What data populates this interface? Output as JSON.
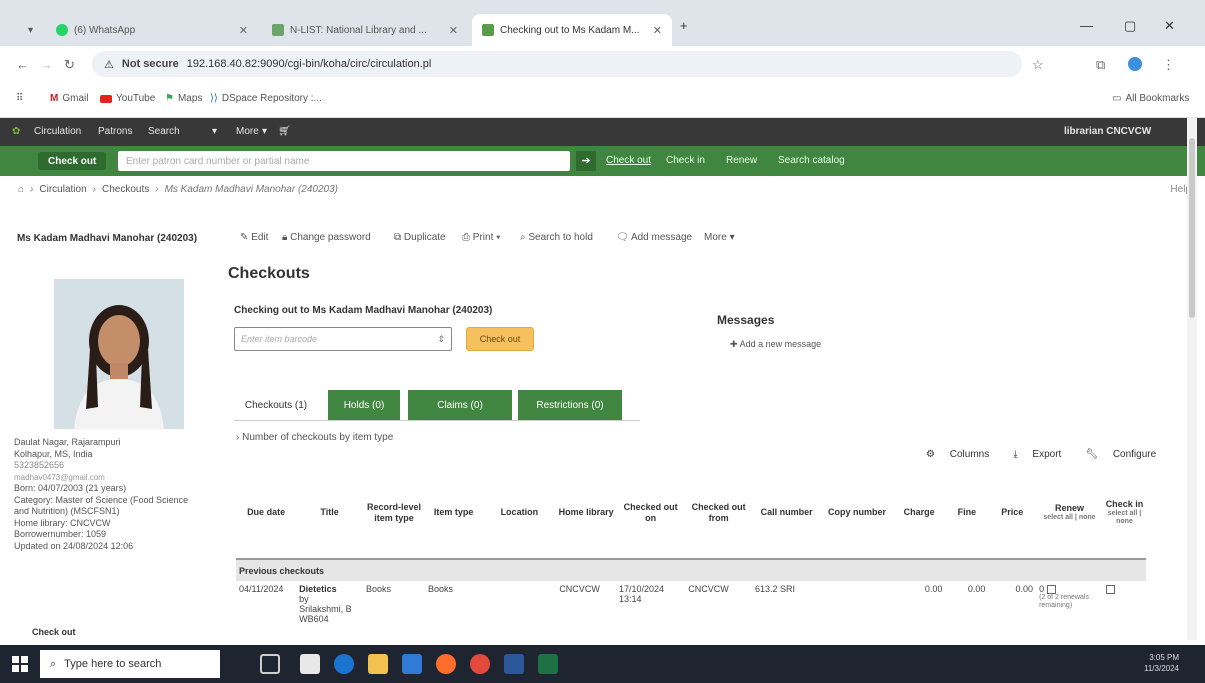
{
  "browser": {
    "tabs": [
      {
        "label": "(6) WhatsApp"
      },
      {
        "label": "N-LIST: National Library and ..."
      },
      {
        "label": "Checking out to Ms Kadam M..."
      }
    ],
    "not_secure": "Not secure",
    "url": "192.168.40.82:9090/cgi-bin/koha/circ/circulation.pl",
    "bookmarks": [
      "Gmail",
      "YouTube",
      "Maps",
      "DSpace Repository :..."
    ],
    "all_bookmarks": "All Bookmarks"
  },
  "koha_nav": {
    "items": [
      "Circulation",
      "Patrons",
      "Search",
      "More",
      "▾"
    ],
    "user": "librarian CNCVCW"
  },
  "checkout_bar": {
    "label": "Check out",
    "placeholder": "Enter patron card number or partial name",
    "links": [
      "Check out",
      "Check in",
      "Renew",
      "Search catalog"
    ]
  },
  "breadcrumb": {
    "items": [
      "Circulation",
      "Checkouts",
      "Ms Kadam Madhavi Manohar (240203)"
    ],
    "help": "Help"
  },
  "patron": {
    "name": "Ms Kadam Madhavi Manohar (240203)",
    "address": "Daulat Nagar, Rajarampuri",
    "city": "Kolhapur, MS, India",
    "phone": "5323852656",
    "email": "madhav0473@gmail.com",
    "born": "Born: 04/07/2003 (21 years)",
    "category": "Category: Master of Science (Food Science and Nutrition) (MSCFSN1)",
    "home_library": "Home library: CNCVCW",
    "borrowernumber": "Borrowernumber: 1059",
    "updated": "Updated on 24/08/2024 12:06",
    "check_out": "Check out"
  },
  "toolbar": {
    "edit": "Edit",
    "change_password": "Change password",
    "duplicate": "Duplicate",
    "print": "Print",
    "search_to_hold": "Search to hold",
    "add_message": "Add message",
    "more": "More"
  },
  "main": {
    "title": "Checkouts",
    "checking_out_to": "Checking out to Ms Kadam Madhavi Manohar (240203)",
    "barcode_placeholder": "Enter item barcode",
    "checkout_button": "Check out",
    "messages_title": "Messages",
    "add_new_message": "Add a new message"
  },
  "tabs": [
    {
      "label": "Checkouts (1)"
    },
    {
      "label": "Holds (0)"
    },
    {
      "label": "Claims (0)"
    },
    {
      "label": "Restrictions (0)"
    }
  ],
  "num_checkouts": "Number of checkouts by item type",
  "table_actions": {
    "columns": "Columns",
    "export": "Export",
    "configure": "Configure"
  },
  "table": {
    "headers": [
      "Due date",
      "Title",
      "Record-level item type",
      "Item type",
      "Location",
      "Home library",
      "Checked out on",
      "Checked out from",
      "Call number",
      "Copy number",
      "Charge",
      "Fine",
      "Price",
      "Renew",
      "Check in"
    ],
    "renew_sub": "select all | none",
    "checkin_sub": "select all | none",
    "group_label": "Previous checkouts",
    "rows": [
      {
        "due": "04/11/2024",
        "title": "Dietetics",
        "by": "by",
        "author": "Srilakshmi, B",
        "barcode": "WB604",
        "record_type": "Books",
        "item_type": "Books",
        "location": "",
        "home_library": "CNCVCW",
        "checked_out_on": "17/10/2024 13:14",
        "checked_out_from": "CNCVCW",
        "call_number": "613.2 SRI",
        "copy_number": "",
        "charge": "0.00",
        "fine": "0.00",
        "price": "0.00",
        "renew_count": "0",
        "renew_note": "(2 of 2 renewals remaining)"
      }
    ]
  },
  "taskbar": {
    "search_placeholder": "Type here to search",
    "time": "3:05 PM",
    "date": "11/3/2024"
  }
}
